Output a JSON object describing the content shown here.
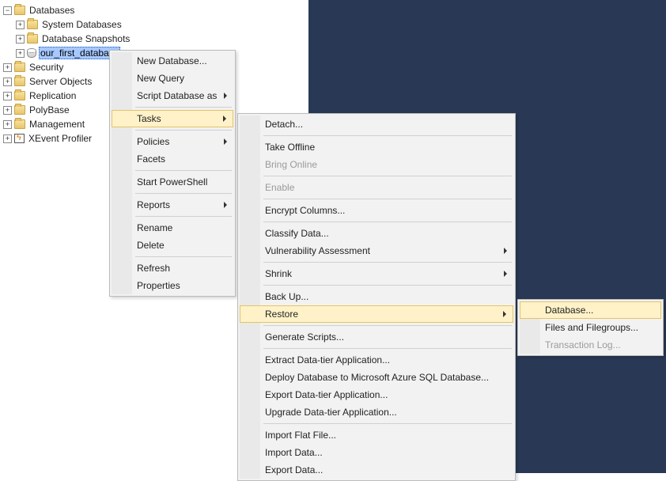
{
  "tree": {
    "root": "Databases",
    "system_databases": "System Databases",
    "database_snapshots": "Database Snapshots",
    "selected_db": "our_first_database",
    "security": "Security",
    "server_objects": "Server Objects",
    "replication": "Replication",
    "polybase": "PolyBase",
    "management": "Management",
    "xevent_profiler": "XEvent Profiler"
  },
  "menu1": {
    "new_database": "New Database...",
    "new_query": "New Query",
    "script_db_as": "Script Database as",
    "tasks": "Tasks",
    "policies": "Policies",
    "facets": "Facets",
    "start_powershell": "Start PowerShell",
    "reports": "Reports",
    "rename": "Rename",
    "delete": "Delete",
    "refresh": "Refresh",
    "properties": "Properties"
  },
  "menu2": {
    "detach": "Detach...",
    "take_offline": "Take Offline",
    "bring_online": "Bring Online",
    "enable": "Enable",
    "encrypt_columns": "Encrypt Columns...",
    "classify_data": "Classify Data...",
    "vuln_assessment": "Vulnerability Assessment",
    "shrink": "Shrink",
    "back_up": "Back Up...",
    "restore": "Restore",
    "generate_scripts": "Generate Scripts...",
    "extract_dt": "Extract Data-tier Application...",
    "deploy_azure": "Deploy Database to Microsoft Azure SQL Database...",
    "export_dt": "Export Data-tier Application...",
    "upgrade_dt": "Upgrade Data-tier Application...",
    "import_flat": "Import Flat File...",
    "import_data": "Import Data...",
    "export_data": "Export Data..."
  },
  "menu3": {
    "database": "Database...",
    "files_filegroups": "Files and Filegroups...",
    "transaction_log": "Transaction Log..."
  }
}
